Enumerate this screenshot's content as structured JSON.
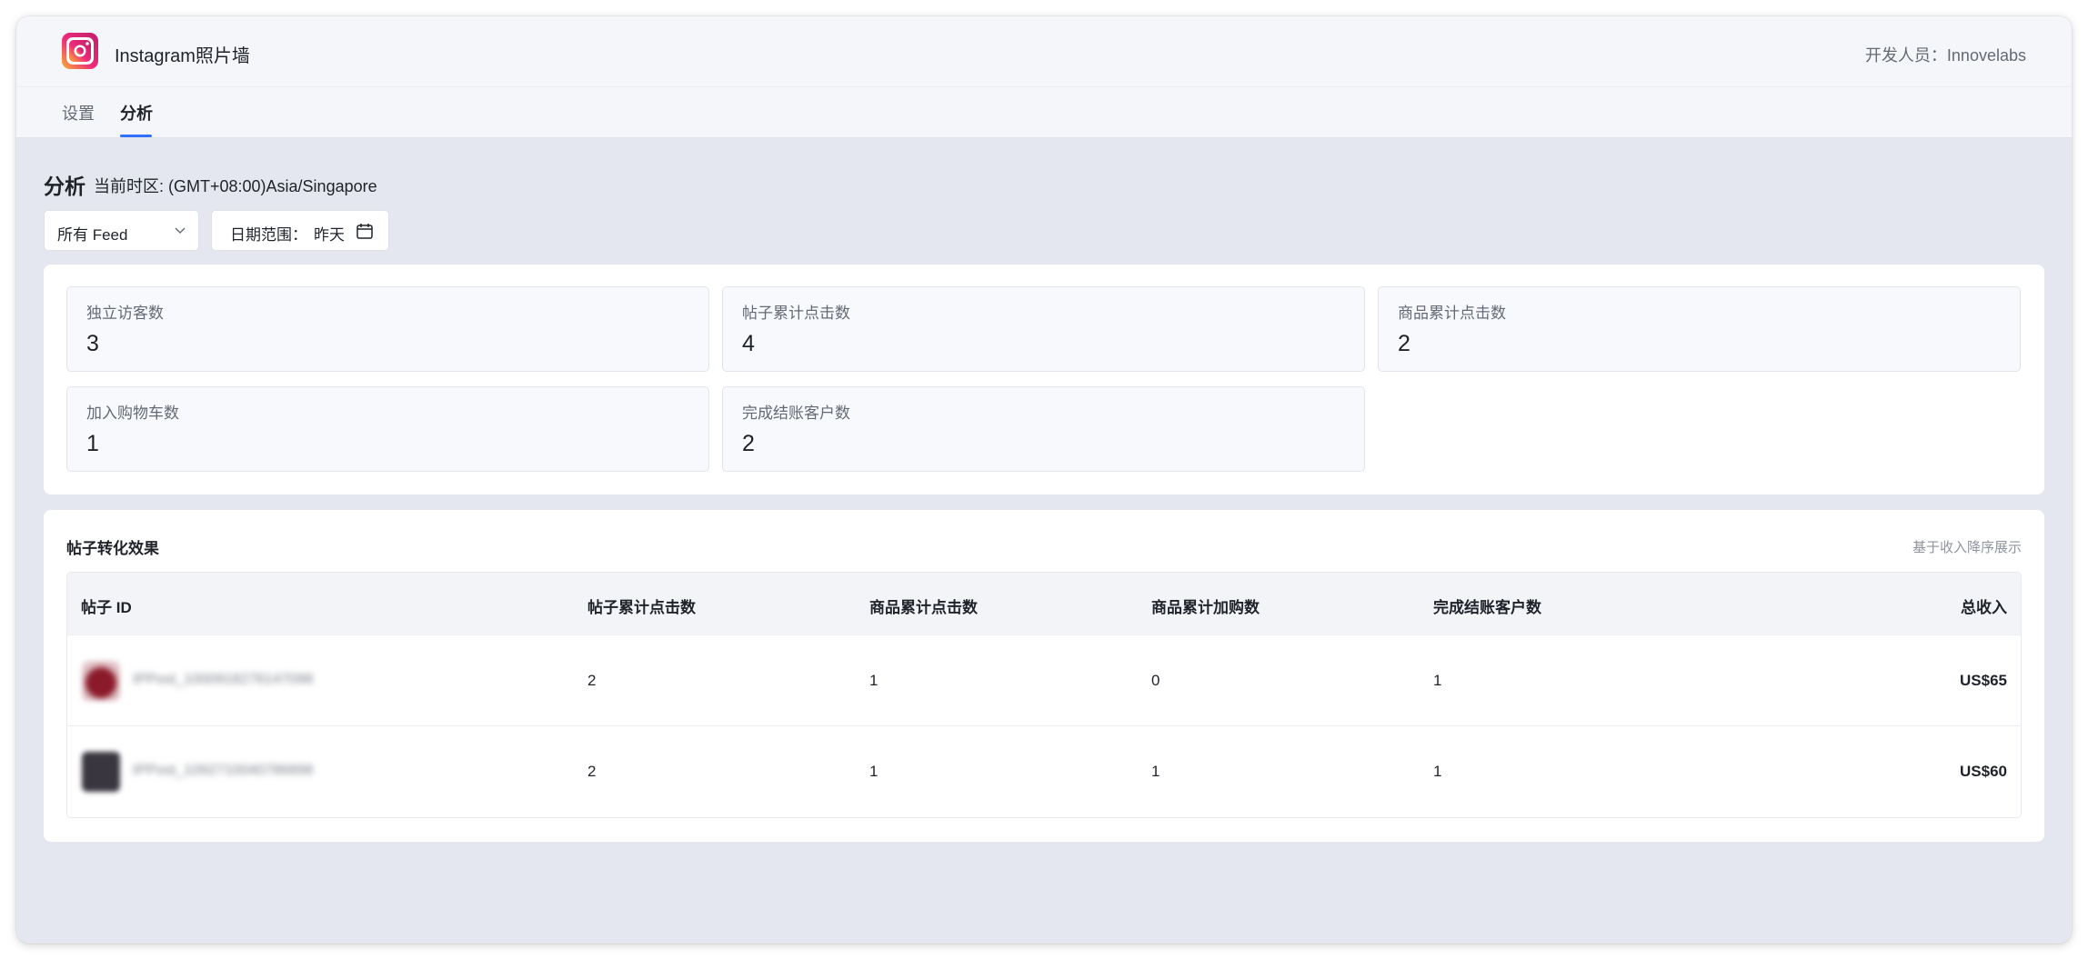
{
  "app": {
    "title": "Instagram照片墙",
    "developer": "开发人员：Innovelabs"
  },
  "tabs": [
    {
      "label": "设置",
      "active": false
    },
    {
      "label": "分析",
      "active": true
    }
  ],
  "page": {
    "title": "分析",
    "timezone": "当前时区: (GMT+08:00)Asia/Singapore"
  },
  "filters": {
    "feed_select": "所有 Feed",
    "date_label": "日期范围：",
    "date_value": "昨天"
  },
  "metrics": [
    {
      "label": "独立访客数",
      "value": "3"
    },
    {
      "label": "帖子累计点击数",
      "value": "4"
    },
    {
      "label": "商品累计点击数",
      "value": "2"
    },
    {
      "label": "加入购物车数",
      "value": "1"
    },
    {
      "label": "完成结账客户数",
      "value": "2"
    }
  ],
  "table": {
    "title": "帖子转化效果",
    "sort_hint": "基于收入降序展示",
    "columns": [
      "帖子 ID",
      "帖子累计点击数",
      "商品累计点击数",
      "商品累计加购数",
      "完成结账客户数",
      "总收入"
    ],
    "rows": [
      {
        "post_id": "IPPost_1000918276147098",
        "post_clicks": "2",
        "product_clicks": "1",
        "add_to_cart": "0",
        "checkouts": "1",
        "revenue": "US$65"
      },
      {
        "post_id": "IPPost_1092710040786898",
        "post_clicks": "2",
        "product_clicks": "1",
        "add_to_cart": "1",
        "checkouts": "1",
        "revenue": "US$60"
      }
    ]
  },
  "colors": {
    "accent": "#3370ff",
    "background": "#e4e7ef",
    "card": "#ffffff"
  },
  "icons": [
    "instagram-logo-icon",
    "chevron-down-icon",
    "calendar-icon"
  ]
}
